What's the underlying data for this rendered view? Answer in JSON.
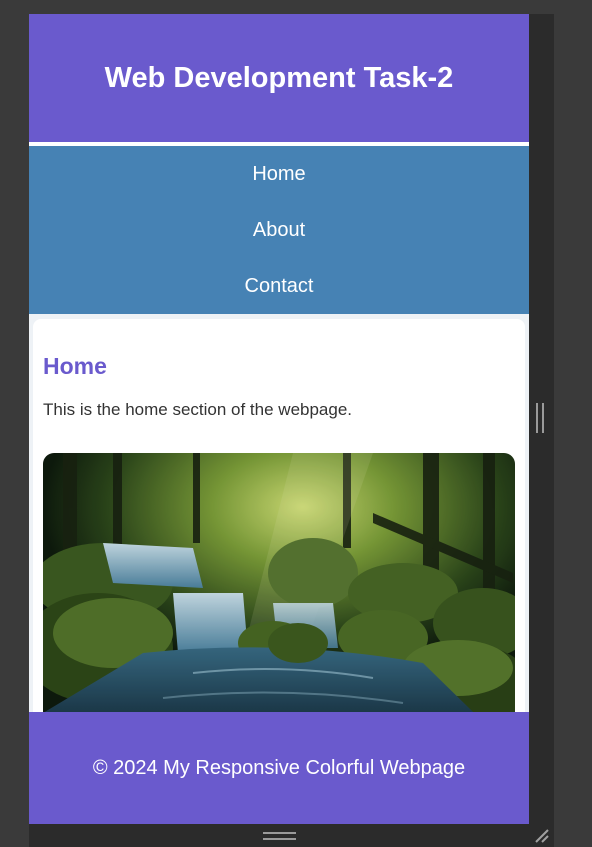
{
  "header": {
    "title": "Web Development Task-2"
  },
  "nav": {
    "items": [
      {
        "label": "Home"
      },
      {
        "label": "About"
      },
      {
        "label": "Contact"
      }
    ]
  },
  "section": {
    "heading": "Home",
    "text": "This is the home section of the webpage.",
    "image": "forest-waterfall"
  },
  "footer": {
    "text": "© 2024 My Responsive Colorful Webpage"
  },
  "colors": {
    "header": "#6a5acd",
    "nav": "#4682b4",
    "footer": "#6a5acd",
    "heading": "#6a5acd"
  }
}
